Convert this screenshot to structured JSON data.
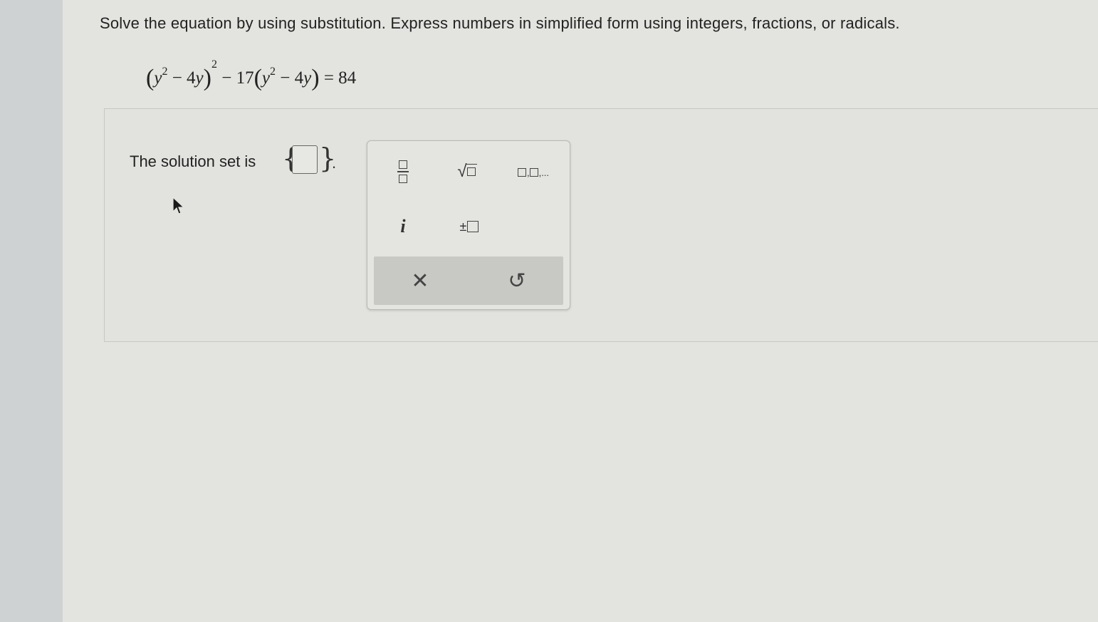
{
  "question": {
    "prompt": "Solve the equation by using substitution. Express numbers in simplified form using integers, fractions, or radicals.",
    "equation": {
      "open": "(",
      "var": "y",
      "exp": "2",
      "minus_term": " − 4",
      "close": ")",
      "outer_exp": "2",
      "middle": " − 17",
      "rhs": " = 84"
    }
  },
  "answer": {
    "label": "The solution set is",
    "open_brace": "{",
    "close_brace": "}",
    "period": ".",
    "value": ""
  },
  "palette": {
    "buttons": [
      {
        "name": "fraction",
        "icon": "fraction-icon"
      },
      {
        "name": "square-root",
        "icon": "sqrt-icon"
      },
      {
        "name": "list",
        "icon": "list-icon",
        "text": ",..."
      },
      {
        "name": "imaginary-unit",
        "icon": "i-icon",
        "text": "i"
      },
      {
        "name": "plus-minus",
        "icon": "plus-minus-icon",
        "text": "±"
      }
    ],
    "actions": [
      {
        "name": "clear",
        "symbol": "✕"
      },
      {
        "name": "undo",
        "symbol": "↺"
      }
    ]
  },
  "colors": {
    "page_bg": "#e3e3df",
    "margin_bg": "#ced2d3",
    "action_bar": "#c8c8c5",
    "text": "#222222"
  }
}
